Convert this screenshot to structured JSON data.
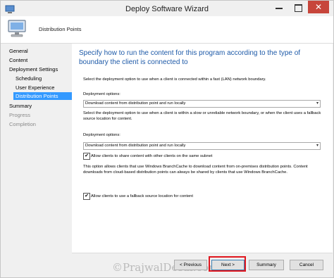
{
  "window": {
    "title": "Deploy Software Wizard",
    "close_glyph": "✕"
  },
  "header": {
    "title": "Distribution Points",
    "icon": "computer-icon"
  },
  "nav": {
    "items": [
      {
        "label": "General",
        "state": "normal"
      },
      {
        "label": "Content",
        "state": "normal"
      },
      {
        "label": "Deployment Settings",
        "state": "normal"
      },
      {
        "label": "Scheduling",
        "state": "normal"
      },
      {
        "label": "User Experience",
        "state": "normal"
      },
      {
        "label": "Distribution Points",
        "state": "selected"
      },
      {
        "label": "Summary",
        "state": "normal"
      },
      {
        "label": "Progress",
        "state": "disabled"
      },
      {
        "label": "Completion",
        "state": "disabled"
      }
    ]
  },
  "main": {
    "heading": "Specify how to run the content for this program according to the type of boundary the client is connected to",
    "fast_intro": "Select the deployment option to use when a client is connected within a fast (LAN) network boundary.",
    "fast_label": "Deployment options:",
    "fast_value": "Download content from distribution point and run locally",
    "slow_intro": "Select the deployment option to use when a client is within a slow or unreliable network boundary, or when the client uses a fallback source location for content.",
    "slow_label": "Deployment options:",
    "slow_value": "Download content from distribution point and run locally",
    "share_label": "Allow clients to share content with other clients on the same subnet",
    "share_checked": true,
    "share_desc": "This option allows clients that use Windows BranchCache to download content from on-premises distribution points. Content downloads from cloud-based distribution points can always be shared by clients that use Windows BranchCache.",
    "fallback_label": "Allow clients to use a fallback source location for content",
    "fallback_checked": true
  },
  "footer": {
    "previous_label": "< Previous",
    "next_label": "Next >",
    "summary_label": "Summary",
    "cancel_label": "Cancel"
  },
  "watermark": "©PrajwalDesai.com",
  "colors": {
    "heading": "#1e5aa8",
    "selection": "#3399ff",
    "highlight_border": "#e0161e",
    "close_button": "#c7453b"
  }
}
